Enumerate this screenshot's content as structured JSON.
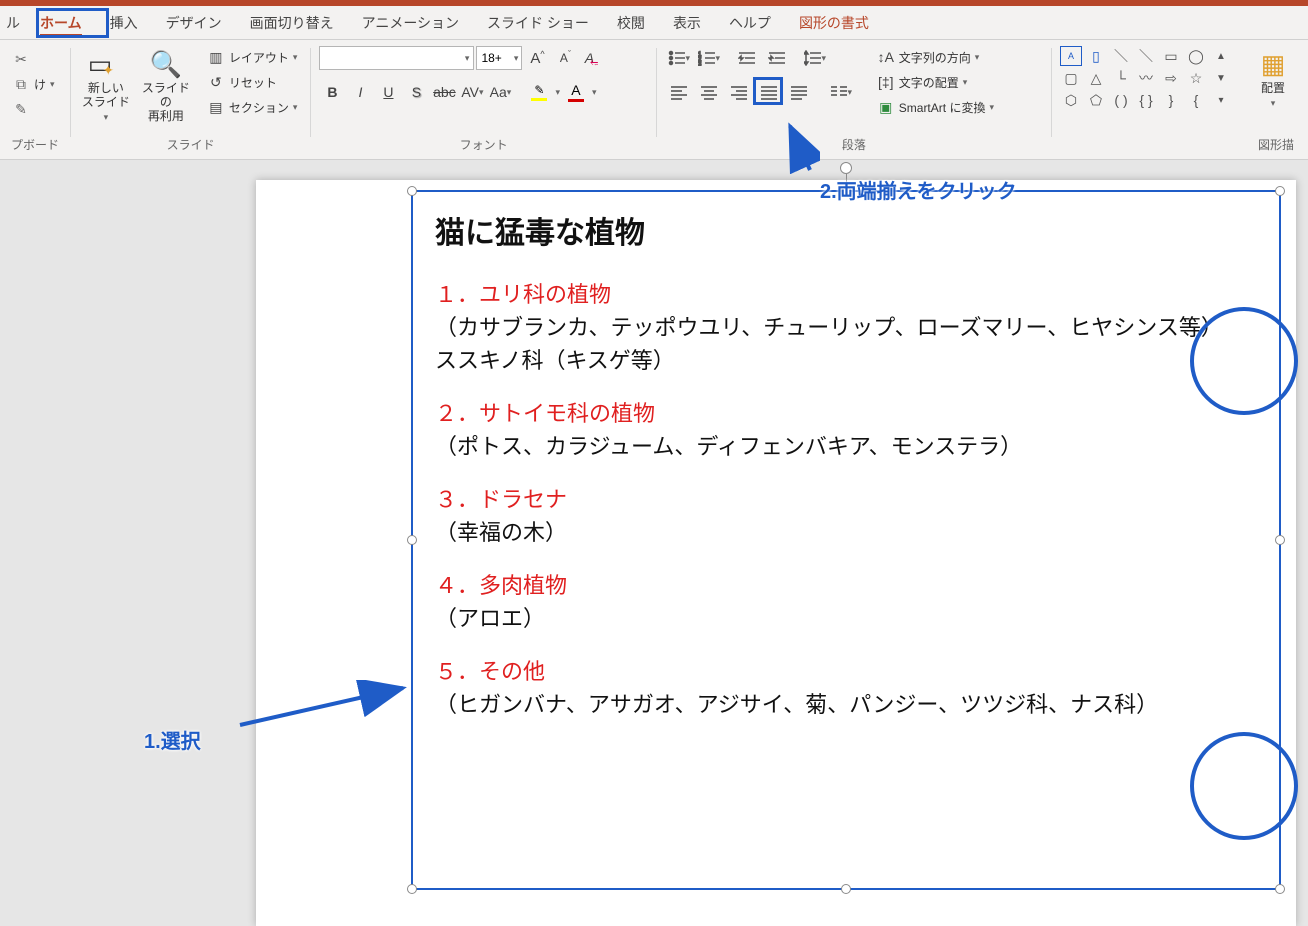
{
  "tabs": {
    "file_stub": "ル",
    "home": "ホーム",
    "insert": "挿入",
    "design": "デザイン",
    "transitions": "画面切り替え",
    "animations": "アニメーション",
    "slideshow": "スライド ショー",
    "review": "校閲",
    "view": "表示",
    "help": "ヘルプ",
    "shape_format": "図形の書式"
  },
  "ribbon": {
    "clipboard": {
      "paste_stub": "け",
      "group_label": "プボード"
    },
    "slides": {
      "new_slide": "新しい\nスライド",
      "reuse": "スライドの\n再利用",
      "layout": "レイアウト",
      "reset": "リセット",
      "section": "セクション",
      "group_label": "スライド"
    },
    "font": {
      "name_value": "",
      "size_value": "18+",
      "bold": "B",
      "italic": "I",
      "underline": "U",
      "shadow": "S",
      "strike": "abc",
      "spacing": "AV",
      "case": "Aa",
      "clear": "A",
      "grow": "A",
      "shrink": "A",
      "group_label": "フォント"
    },
    "paragraph": {
      "text_direction": "文字列の方向",
      "text_align": "文字の配置",
      "smartart": "SmartArt に変換",
      "group_label": "段落"
    },
    "drawing": {
      "arrange": "配置",
      "group_label": "図形描"
    }
  },
  "annotations": {
    "step1": "1.選択",
    "step2": "2.両端揃えをクリック"
  },
  "slide_content": {
    "title": "猫に猛毒な植物",
    "s1_head": "１．ユリ科の植物",
    "s1_body1": "（カサブランカ、テッポウユリ、チューリップ、ローズマリー、ヒヤシンス等）",
    "s1_body2": "ススキノ科（キスゲ等）",
    "s2_head": "２．サトイモ科の植物",
    "s2_body": "（ポトス、カラジューム、ディフェンバキア、モンステラ）",
    "s3_head": "３．ドラセナ",
    "s3_body": "（幸福の木）",
    "s4_head": "４．多肉植物",
    "s4_body": "（アロエ）",
    "s5_head": "５．その他",
    "s5_body": "（ヒガンバナ、アサガオ、アジサイ、菊、パンジー、ツツジ科、ナス科）"
  }
}
